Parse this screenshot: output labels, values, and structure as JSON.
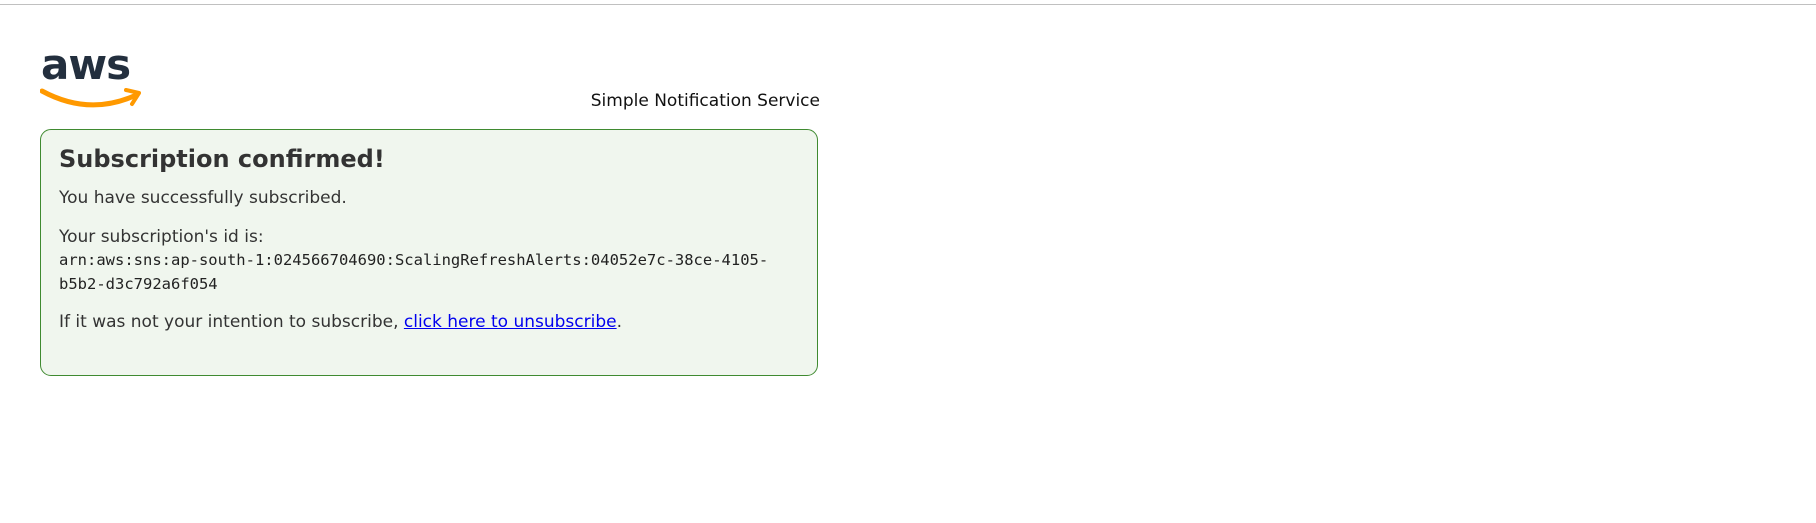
{
  "brand": {
    "logo_text": "aws",
    "service_name": "Simple Notification Service",
    "colors": {
      "logo_text": "#232f3e",
      "logo_smile": "#ff9900"
    }
  },
  "message": {
    "title": "Subscription confirmed!",
    "success_text": "You have successfully subscribed.",
    "id_label": "Your subscription's id is:",
    "subscription_arn": "arn:aws:sns:ap-south-1:024566704690:ScalingRefreshAlerts:04052e7c-38ce-4105-b5b2-d3c792a6f054",
    "unsubscribe_prefix": "If it was not your intention to subscribe, ",
    "unsubscribe_link": "click here to unsubscribe",
    "unsubscribe_suffix": "."
  },
  "colors": {
    "box_border": "#3f8a30",
    "box_background": "#f0f6ee",
    "link": "#0000ee"
  }
}
